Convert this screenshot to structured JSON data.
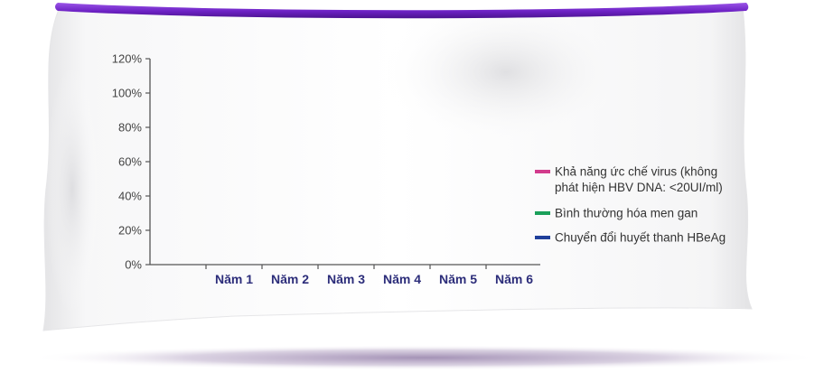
{
  "colors": {
    "rod": "#7a2fd0",
    "axis": "#555555",
    "category_text": "#2c2d7a"
  },
  "chart_data": {
    "type": "line",
    "title": "",
    "xlabel": "",
    "ylabel": "",
    "categories": [
      "Năm 1",
      "Năm 2",
      "Năm 3",
      "Năm 4",
      "Năm 5",
      "Năm 6"
    ],
    "y_ticks": [
      "0%",
      "20%",
      "40%",
      "60%",
      "80%",
      "100%",
      "120%"
    ],
    "ylim": [
      0,
      120
    ],
    "grid": false,
    "legend_position": "right",
    "series": [
      {
        "name": "Khả năng ức chế virus (không phát hiện HBV DNA: <20UI/ml)",
        "name_lines": [
          "Khả năng ức chế virus (không",
          "phát hiện HBV DNA: <20UI/ml)"
        ],
        "color": "#d23b8c",
        "values": []
      },
      {
        "name": "Bình thường hóa men gan",
        "name_lines": [
          "Bình thường hóa men gan"
        ],
        "color": "#1aa05a",
        "values": []
      },
      {
        "name": "Chuyển đổi huyết thanh HBeAg",
        "name_lines": [
          "Chuyển đổi huyết thanh HBeAg"
        ],
        "color": "#1f3f9a",
        "values": []
      }
    ]
  }
}
